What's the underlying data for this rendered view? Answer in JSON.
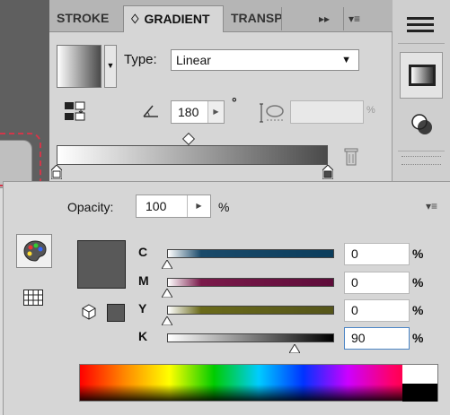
{
  "gradient_panel": {
    "tabs": [
      {
        "label": "STROKE",
        "active": false
      },
      {
        "label": "♢ GRADIENT",
        "active": true
      },
      {
        "label": "TRANSPARENCY",
        "active": false
      }
    ],
    "overflow_icon": "▸▸",
    "menu_icon": "≡",
    "type_label": "Type:",
    "type_value": "Linear",
    "angle_value": "180",
    "angle_unit": "°",
    "aspect_value": "",
    "aspect_unit": "%",
    "ramp_start_color": "#ffffff",
    "ramp_end_color": "#4a4a4a"
  },
  "side_toolbar": {
    "buttons": [
      "panel-menu-icon",
      "gradient-icon",
      "transparency-icon"
    ]
  },
  "color_panel": {
    "opacity_label": "Opacity:",
    "opacity_value": "100",
    "opacity_unit": "%",
    "menu_icon": "≡",
    "fill_color": "#595959",
    "channels": [
      {
        "label": "C",
        "value": "0",
        "unit": "%",
        "fraction": 0.0
      },
      {
        "label": "M",
        "value": "0",
        "unit": "%",
        "fraction": 0.0
      },
      {
        "label": "Y",
        "value": "0",
        "unit": "%",
        "fraction": 0.0
      },
      {
        "label": "K",
        "value": "90",
        "unit": "%",
        "fraction": 0.9
      }
    ]
  }
}
